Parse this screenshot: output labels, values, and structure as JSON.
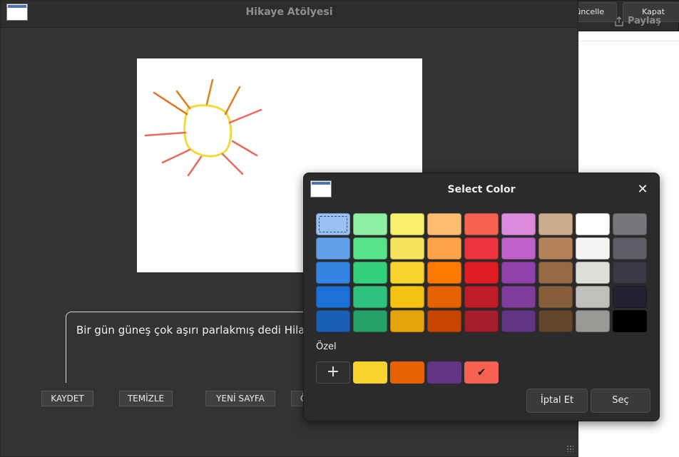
{
  "background_window": {
    "refresh_label": "Güncelle",
    "close_label": "Kapat",
    "share_label": "Paylaş"
  },
  "main_window": {
    "title": "Hikaye Atölyesi",
    "story_text": "Bir gün güneş çok aşırı parlakmış dedi Hilal sı",
    "buttons": {
      "save": "KAYDET",
      "clear": "TEMİZLE",
      "new_page": "YENİ SAYFA",
      "partial": "Ö"
    }
  },
  "color_dialog": {
    "title": "Select Color",
    "custom_label": "Özel",
    "cancel_label": "İptal Et",
    "select_label": "Seç",
    "add_custom_symbol": "+",
    "palette_rows": [
      [
        "#99c1f1",
        "#8ff0a4",
        "#f9f06b",
        "#ffbe6f",
        "#f66151",
        "#dc8add",
        "#cdab8f",
        "#ffffff",
        "#77767b"
      ],
      [
        "#62a0ea",
        "#57e389",
        "#f8e45c",
        "#ffa348",
        "#ed333b",
        "#c061cb",
        "#b5835a",
        "#f6f5f4",
        "#5e5c64"
      ],
      [
        "#3584e4",
        "#33d17a",
        "#f6d32d",
        "#ff7800",
        "#e01b24",
        "#9141ac",
        "#986a44",
        "#deddda",
        "#3d3846"
      ],
      [
        "#1c71d8",
        "#2ec27e",
        "#f5c211",
        "#e66100",
        "#c01c28",
        "#813d9c",
        "#865e3c",
        "#c0bfbc",
        "#241f31"
      ],
      [
        "#1a5fb4",
        "#26a269",
        "#e5a50a",
        "#c64600",
        "#a51d2d",
        "#613583",
        "#63452c",
        "#9a9996",
        "#000000"
      ]
    ],
    "selected_swatch": "#99c1f1",
    "custom_colors": [
      "#f6d32d",
      "#e66100",
      "#613583",
      "#f66151"
    ],
    "custom_selected": "#f66151"
  }
}
